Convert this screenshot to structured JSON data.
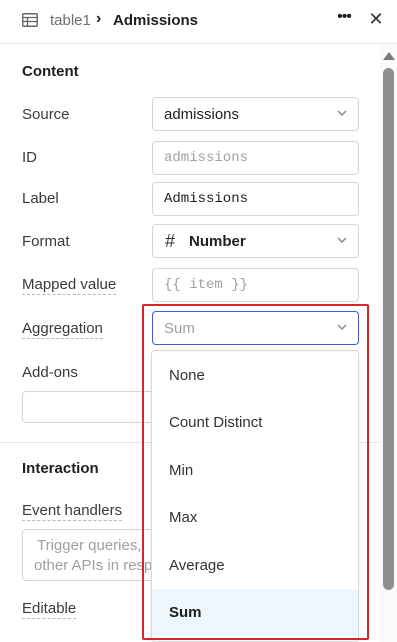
{
  "header": {
    "crumb": "table1",
    "separator": "›",
    "title": "Admissions",
    "more_glyph": "•••",
    "close_glyph": "✕",
    "icons": {
      "table": "table-icon",
      "more": "more-horizontal-icon",
      "close": "close-icon"
    }
  },
  "content": {
    "section_title": "Content",
    "source": {
      "label": "Source",
      "value": "admissions"
    },
    "id": {
      "label": "ID",
      "placeholder": "admissions"
    },
    "label_field": {
      "label": "Label",
      "value": "Admissions"
    },
    "format": {
      "label": "Format",
      "icon_glyph": "#",
      "value": "Number"
    },
    "mapped_value": {
      "label": "Mapped value",
      "placeholder": "{{ item }}"
    },
    "aggregation": {
      "label": "Aggregation",
      "placeholder": "Sum"
    },
    "addons": {
      "label": "Add-ons"
    }
  },
  "interaction": {
    "section_title": "Interaction",
    "event_handlers": {
      "label": "Event handlers",
      "placeholder_line1": "Trigger queries,",
      "placeholder_line2": "other APIs in resp"
    },
    "editable": {
      "label": "Editable"
    }
  },
  "aggregation_dropdown": {
    "options": [
      "None",
      "Count Distinct",
      "Min",
      "Max",
      "Average",
      "Sum"
    ],
    "selected": "Sum"
  },
  "colors": {
    "highlight": "#d6252d",
    "focus": "#3c5dd8",
    "selected_option_bg": "#eef5fb"
  }
}
